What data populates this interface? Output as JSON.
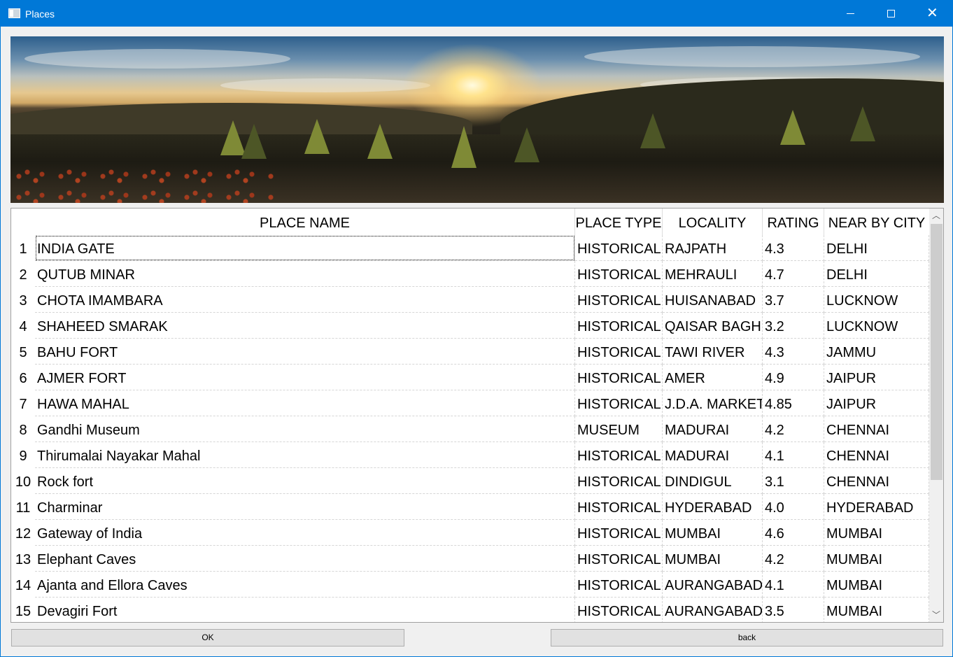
{
  "window": {
    "title": "Places",
    "minimize_label": "",
    "maximize_label": "",
    "close_glyph": "✕"
  },
  "icons": {
    "app": "window-app-icon",
    "minimize": "minimize-icon",
    "maximize": "maximize-icon",
    "close": "close-icon",
    "scroll_up": "chevron-up-icon",
    "scroll_down": "chevron-down-icon"
  },
  "table": {
    "headers": [
      "PLACE NAME",
      "PLACE TYPE",
      "LOCALITY",
      "RATING",
      "NEAR BY CITY"
    ],
    "rows": [
      {
        "num": "1",
        "cells": [
          "INDIA GATE",
          "HISTORICAL",
          "RAJPATH",
          "4.3",
          "DELHI"
        ]
      },
      {
        "num": "2",
        "cells": [
          "QUTUB MINAR",
          "HISTORICAL",
          "MEHRAULI",
          "4.7",
          "DELHI"
        ]
      },
      {
        "num": "3",
        "cells": [
          "CHOTA IMAMBARA",
          "HISTORICAL",
          "HUISANABAD",
          "3.7",
          "LUCKNOW"
        ]
      },
      {
        "num": "4",
        "cells": [
          "SHAHEED SMARAK",
          "HISTORICAL",
          "QAISAR BAGH",
          "3.2",
          "LUCKNOW"
        ]
      },
      {
        "num": "5",
        "cells": [
          "BAHU FORT",
          "HISTORICAL",
          "TAWI RIVER",
          "4.3",
          "JAMMU"
        ]
      },
      {
        "num": "6",
        "cells": [
          "AJMER FORT",
          "HISTORICAL",
          "AMER",
          "4.9",
          "JAIPUR"
        ]
      },
      {
        "num": "7",
        "cells": [
          "HAWA MAHAL",
          "HISTORICAL",
          "J.D.A. MARKET",
          "4.85",
          "JAIPUR"
        ]
      },
      {
        "num": "8",
        "cells": [
          "Gandhi Museum",
          "MUSEUM",
          "MADURAI",
          "4.2",
          "CHENNAI"
        ]
      },
      {
        "num": "9",
        "cells": [
          "Thirumalai Nayakar Mahal",
          "HISTORICAL",
          "MADURAI",
          "4.1",
          "CHENNAI"
        ]
      },
      {
        "num": "10",
        "cells": [
          "Rock fort",
          "HISTORICAL",
          "DINDIGUL",
          "3.1",
          "CHENNAI"
        ]
      },
      {
        "num": "11",
        "cells": [
          "Charminar",
          "HISTORICAL",
          "HYDERABAD",
          "4.0",
          "HYDERABAD"
        ]
      },
      {
        "num": "12",
        "cells": [
          "Gateway of India",
          "HISTORICAL",
          "MUMBAI",
          "4.6",
          "MUMBAI"
        ]
      },
      {
        "num": "13",
        "cells": [
          "Elephant Caves",
          "HISTORICAL",
          "MUMBAI",
          "4.2",
          "MUMBAI"
        ]
      },
      {
        "num": "14",
        "cells": [
          "Ajanta and Ellora Caves",
          "HISTORICAL",
          "AURANGABAD",
          "4.1",
          "MUMBAI"
        ]
      },
      {
        "num": "15",
        "cells": [
          "Devagiri Fort",
          "HISTORICAL",
          "AURANGABAD",
          "3.5",
          "MUMBAI"
        ]
      }
    ],
    "selected_row": 0,
    "selected_col": 0
  },
  "scrollbar": {
    "up_glyph": "︿",
    "down_glyph": "﹀",
    "visible_fraction": 0.62
  },
  "buttons": {
    "ok_label": "OK",
    "back_label": "back"
  },
  "colors": {
    "titlebar": "#0078d7",
    "window_bg": "#f0f0f0",
    "button_bg": "#e1e1e1"
  }
}
